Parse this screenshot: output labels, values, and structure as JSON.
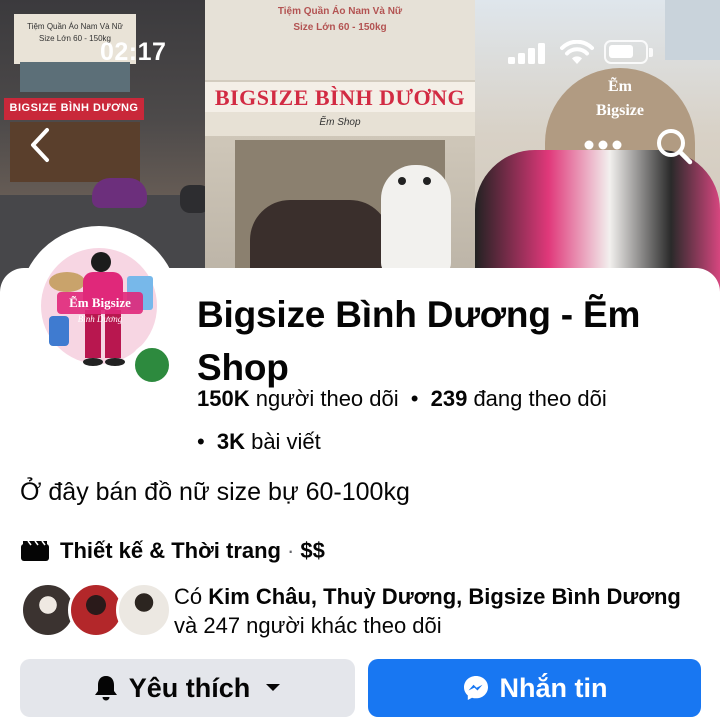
{
  "status_bar": {
    "time": "02:17"
  },
  "cover": {
    "panel1_storefront_text": "Tiệm Quần Áo Nam Và Nữ",
    "panel1_size_text": "Size Lớn 60 - 150kg",
    "panel1_sign": "BIGSIZE BÌNH DƯƠNG",
    "panel2_storefront_text": "Tiệm Quần Áo Nam Và Nữ",
    "panel2_size_text": "Size Lớn 60 - 150kg",
    "panel2_sign": "BIGSIZE BÌNH DƯƠNG",
    "panel2_subsign": "Ẽm Shop",
    "panel3_sign_line1": "Ẽm",
    "panel3_sign_line2": "Bigsize"
  },
  "avatar": {
    "logo_line1": "Ẽm Bigsize",
    "logo_line2": "Bình Dương"
  },
  "profile": {
    "name": "Bigsize Bình Dương - Ẽm Shop",
    "followers_count": "150K",
    "followers_label": "người theo dõi",
    "following_count": "239",
    "following_label": "đang theo dõi",
    "posts_count": "3K",
    "posts_label": "bài viết",
    "separator": "•",
    "bio": "Ở đây bán đồ nữ size bự 60-100kg",
    "category": "Thiết kế & Thời trang",
    "category_separator": "·",
    "price_range": "$$"
  },
  "mutual": {
    "prefix": "Có",
    "names": "Kim Châu, Thuỳ Dương, Bigsize Bình Dương",
    "suffix": "và 247 người khác theo dõi"
  },
  "actions": {
    "like_label": "Yêu thích",
    "message_label": "Nhắn tin"
  },
  "colors": {
    "primary_blue": "#1877f2",
    "secondary_gray": "#e4e6eb",
    "online_green": "#2d8a3e",
    "text": "#050505"
  },
  "icons": [
    "back-icon",
    "more-icon",
    "search-icon",
    "category-icon",
    "bell-icon",
    "caret-down-icon",
    "messenger-icon",
    "signal-icon",
    "wifi-icon",
    "battery-icon"
  ]
}
